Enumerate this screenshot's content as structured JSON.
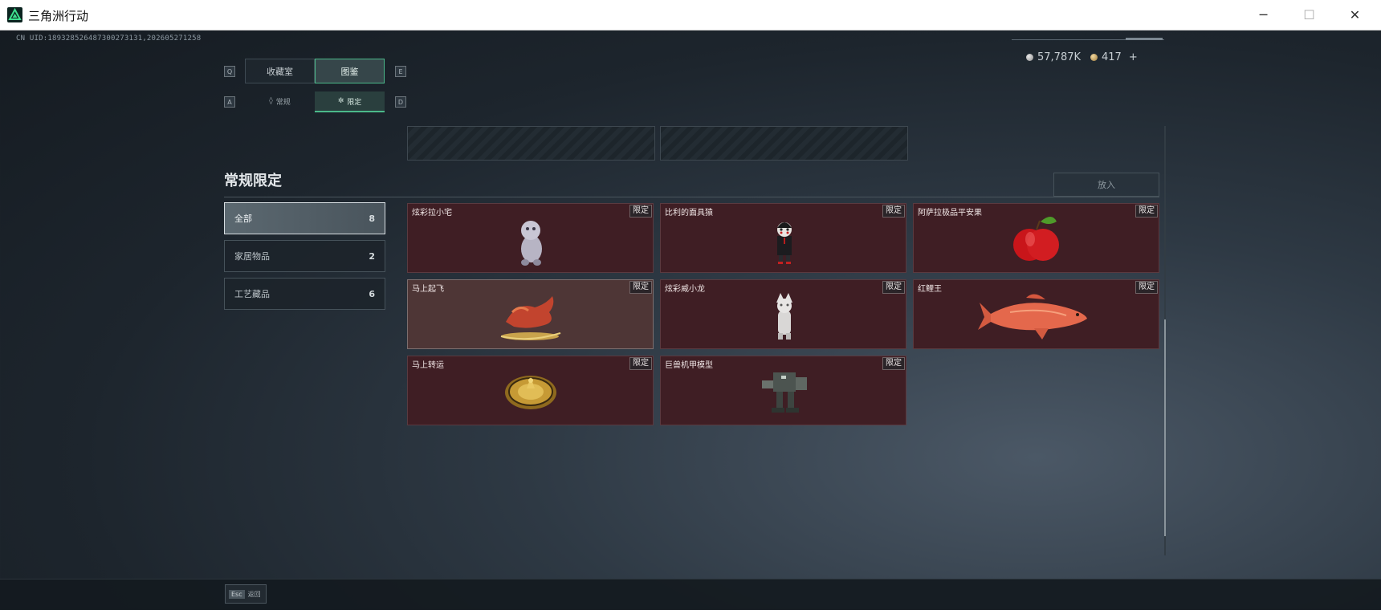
{
  "window": {
    "title": "三角洲行动",
    "minimize_icon": "─",
    "maximize_icon": "☐",
    "close_icon": "✕"
  },
  "uid_text": "CN UID:18932852648730027313​1,202605271258",
  "currency": {
    "silver_value": "57,787K",
    "gold_value": "417",
    "add_symbol": "+"
  },
  "tabs": {
    "main": [
      {
        "label": "收藏室",
        "active": false
      },
      {
        "label": "图鉴",
        "active": true
      }
    ],
    "main_left_key": "Q",
    "main_right_key": "E",
    "sub": [
      {
        "label": "常规",
        "active": false
      },
      {
        "label": "限定",
        "active": true
      }
    ],
    "sub_left_key": "A",
    "sub_right_key": "D"
  },
  "section": {
    "title": "常规限定",
    "put_in_label": "放入"
  },
  "categories": [
    {
      "label": "全部",
      "count": "8",
      "active": true
    },
    {
      "label": "家居物品",
      "count": "2",
      "active": false
    },
    {
      "label": "工艺藏品",
      "count": "6",
      "active": false
    }
  ],
  "items": [
    {
      "name": "炫彩拉小宅",
      "tag": "限定",
      "icon": "plush-doll-icon"
    },
    {
      "name": "比利的面具猿",
      "tag": "限定",
      "icon": "puppet-figure-icon"
    },
    {
      "name": "阿萨拉极品平安果",
      "tag": "限定",
      "icon": "apple-icon"
    },
    {
      "name": "马上起飞",
      "tag": "限定",
      "icon": "horse-statue-icon"
    },
    {
      "name": "炫彩威小龙",
      "tag": "限定",
      "icon": "dragon-figure-icon"
    },
    {
      "name": "红鲤王",
      "tag": "限定",
      "icon": "carp-fish-icon"
    },
    {
      "name": "马上转运",
      "tag": "限定",
      "icon": "golden-compass-icon"
    },
    {
      "name": "巨兽机甲模型",
      "tag": "限定",
      "icon": "mech-model-icon"
    }
  ],
  "colors": {
    "accent": "#4bb98a",
    "card_bg": "#3f1e24",
    "card_hover_bg": "#4e3636"
  },
  "bottom": {
    "esc_key": "Esc",
    "esc_label": "返回"
  }
}
